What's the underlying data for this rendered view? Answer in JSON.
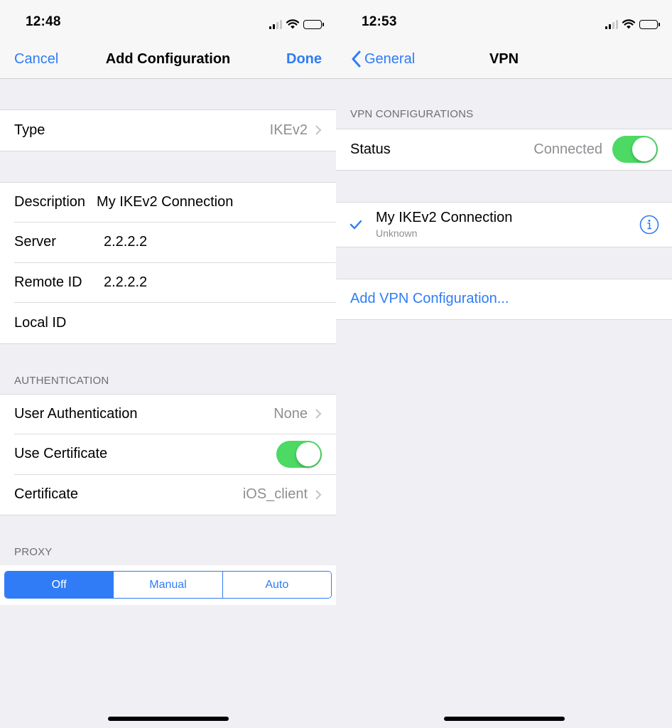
{
  "left": {
    "status": {
      "time": "12:48"
    },
    "nav": {
      "cancel": "Cancel",
      "title": "Add Configuration",
      "done": "Done"
    },
    "type_row": {
      "label": "Type",
      "value": "IKEv2"
    },
    "details": [
      {
        "label": "Description",
        "value": "My IKEv2 Connection"
      },
      {
        "label": "Server",
        "value": "2.2.2.2"
      },
      {
        "label": "Remote ID",
        "value": "2.2.2.2"
      },
      {
        "label": "Local ID",
        "value": ""
      }
    ],
    "auth_header": "AUTHENTICATION",
    "auth": {
      "user_auth_label": "User Authentication",
      "user_auth_value": "None",
      "use_cert_label": "Use Certificate",
      "use_cert_on": true,
      "cert_label": "Certificate",
      "cert_value": "iOS_client"
    },
    "proxy_header": "PROXY",
    "proxy": {
      "options": [
        "Off",
        "Manual",
        "Auto"
      ],
      "selected": "Off"
    }
  },
  "right": {
    "status": {
      "time": "12:53"
    },
    "nav": {
      "back": "General",
      "title": "VPN"
    },
    "config_header": "VPN CONFIGURATIONS",
    "status_row": {
      "label": "Status",
      "value": "Connected",
      "on": true
    },
    "vpn": {
      "name": "My IKEv2 Connection",
      "sub": "Unknown",
      "checked": true
    },
    "add_link": "Add VPN Configuration..."
  },
  "colors": {
    "accent": "#2f7cf6",
    "toggle_on": "#4cd964",
    "background": "#efeff4"
  }
}
